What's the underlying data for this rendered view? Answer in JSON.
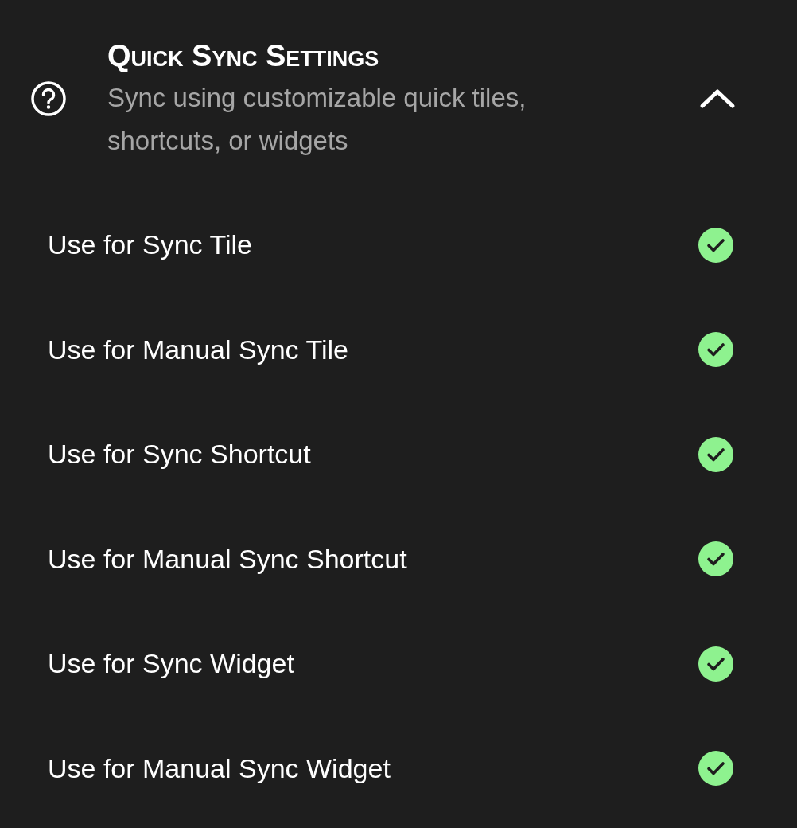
{
  "section": {
    "title": "Quick Sync Settings",
    "subtitle": "Sync using customizable quick tiles, shortcuts, or widgets",
    "expanded": true
  },
  "options": [
    {
      "label": "Use for Sync Tile",
      "checked": true
    },
    {
      "label": "Use for Manual Sync Tile",
      "checked": true
    },
    {
      "label": "Use for Sync Shortcut",
      "checked": true
    },
    {
      "label": "Use for Manual Sync Shortcut",
      "checked": true
    },
    {
      "label": "Use for Sync Widget",
      "checked": true
    },
    {
      "label": "Use for Manual Sync Widget",
      "checked": true
    }
  ]
}
